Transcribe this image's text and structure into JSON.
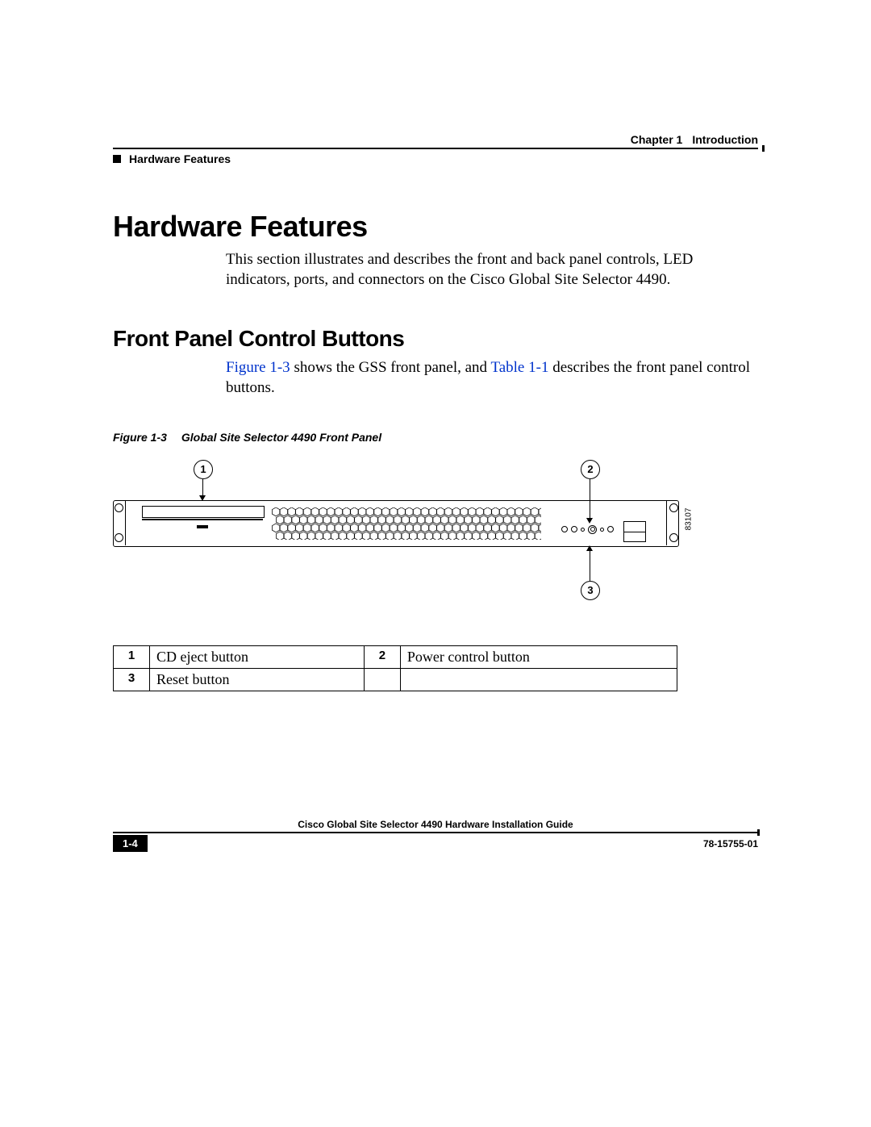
{
  "header": {
    "chapter_label": "Chapter 1",
    "chapter_title": "Introduction",
    "running_head": "Hardware Features"
  },
  "h1": "Hardware Features",
  "intro_para": "This section illustrates and describes the front and back panel controls, LED indicators, ports, and connectors on the Cisco Global Site Selector 4490.",
  "h2": "Front Panel Control Buttons",
  "para2_pre": "",
  "para2_link1": "Figure 1-3",
  "para2_mid1": " shows the GSS front panel, and ",
  "para2_link2": "Table 1-1",
  "para2_mid2": " describes the front panel control buttons.",
  "figure": {
    "label": "Figure 1-3",
    "title": "Global Site Selector 4490 Front Panel",
    "part_number": "83107",
    "callouts": {
      "c1": "1",
      "c2": "2",
      "c3": "3"
    }
  },
  "table": {
    "r1n": "1",
    "r1t": "CD eject button",
    "r2n": "2",
    "r2t": "Power control button",
    "r3n": "3",
    "r3t": "Reset button"
  },
  "footer": {
    "book_title": "Cisco Global Site Selector 4490 Hardware Installation Guide",
    "page": "1-4",
    "doc_number": "78-15755-01"
  }
}
